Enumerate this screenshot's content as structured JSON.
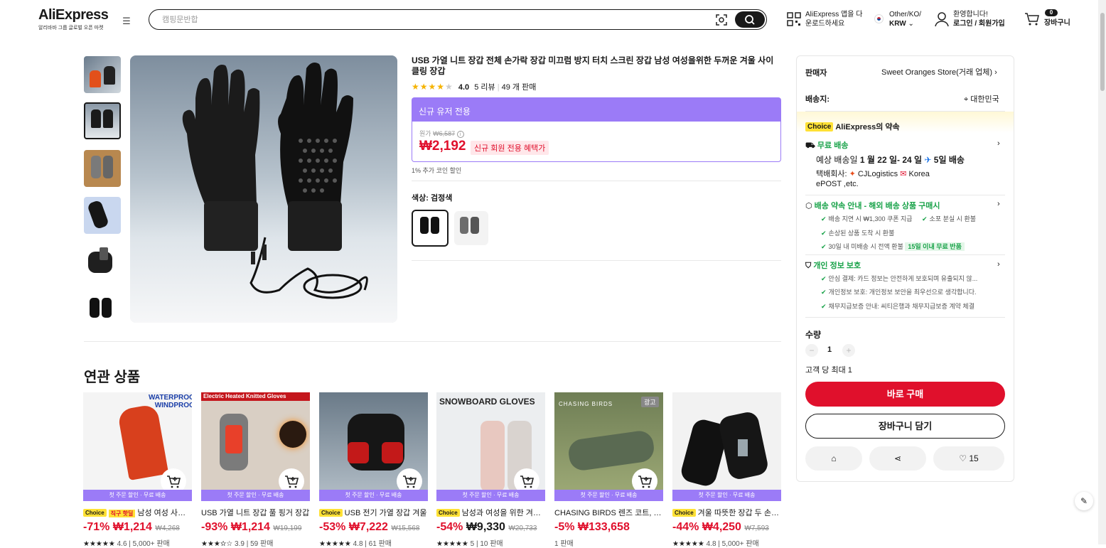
{
  "header": {
    "logo": "AliExpress",
    "logo_sub": "알리바바 그룹 글로벌 오픈 마켓",
    "search_placeholder": "캠핑문반합",
    "app_line1": "AliExpress 앱을 다",
    "app_line2": "운로드하세요",
    "region_line1": "Other/KO/",
    "region_line2": "KRW",
    "greeting": "환영합니다!",
    "login": "로그인 / 회원가입",
    "cart_count": "0",
    "cart_label": "장바구니"
  },
  "product": {
    "title": "USB 가열 니트 장갑 전체 손가락 장갑 미끄럼 방지 터치 스크린 장갑 남성 여성을위한 두꺼운 겨울 사이클링 장갑",
    "rating": "4.0",
    "reviews": "5 리뷰",
    "sold": "49 개 판매",
    "rating_value": 4.0,
    "new_user_banner": "신규 유저 전용",
    "orig_label": "원가",
    "orig_price": "₩6,587",
    "price": "₩2,192",
    "promo_tag": "신규 회원 전용 혜택가",
    "coin": "1% 추가 코인 할인",
    "color_label": "색상: 검정색"
  },
  "panel": {
    "seller_label": "판매자",
    "seller_value": "Sweet Oranges Store(거래 업체)",
    "ship_label": "배송지:",
    "ship_value": "대한민국",
    "choice_badge": "Choice",
    "promise": "AliExpress의 약속",
    "free_ship": "무료 배송",
    "eta_prefix": "예상 배송일",
    "eta_range": "1 월 22 일- 24 일",
    "eta_days": "5일 배송",
    "carrier_prefix": "택배회사:",
    "carrier1": "CJLogistics",
    "carrier2": "Korea",
    "carrier3": "ePOST ,etc.",
    "guarantee_title": "배송 약속 안내 - 해외 배송 상품 구매시",
    "g1": "배송 지연 시 ₩1,300 쿠폰 지급",
    "g2": "소포 분실 시 환불",
    "g3": "손상된 상품 도착 시 환불",
    "g4": "30일 내 미배송 시 전액 환불",
    "g4_tag": "15일 이내 무료 반품",
    "privacy_title": "개인 정보 보호",
    "p1": "안심 결제: 카드 정보는 안전하게 보호되며 유출되지 않...",
    "p2": "개인정보 보호: 개인정보 보안을 최우선으로 생각합니다.",
    "p3": "채무지급보증 안내: 씨티은행과 채무지급보증 계약 체결",
    "qty_label": "수량",
    "qty_value": "1",
    "qty_limit": "고객 당 최대 1",
    "buy_now": "바로 구매",
    "add_cart": "장바구니 담기",
    "wish_count": "15"
  },
  "related": {
    "title": "연관 상품",
    "band": "첫 주문 할인 · 무료 배송",
    "ad_badge": "광고",
    "items": [
      {
        "choice": "Choice",
        "tag": "직구 핫딜",
        "title": "남성 여성 사이클링 장갑",
        "discount": "-71%",
        "price": "₩1,214",
        "orig": "₩4,268",
        "rating": "4.6",
        "sold": "5,000+ 판매",
        "img_text": "WATERPROOF WINDPROOF"
      },
      {
        "choice": "",
        "tag": "",
        "title": "USB 가열 니트 장갑 풀 핑거 장갑",
        "discount": "-93%",
        "price": "₩1,214",
        "orig": "₩19,199",
        "rating": "3.9",
        "sold": "59 판매",
        "img_text": "Electric Heated Knitted Gloves"
      },
      {
        "choice": "Choice",
        "tag": "",
        "title": "USB 전기 가열 장갑 겨울",
        "discount": "-53%",
        "price": "₩7,222",
        "orig": "₩15,568",
        "rating": "4.8",
        "sold": "61 판매",
        "img_text": ""
      },
      {
        "choice": "Choice",
        "tag": "",
        "title": "남성과 여성을 위한 겨울 장갑",
        "discount": "-54%",
        "price": "₩9,330",
        "orig": "₩20,733",
        "rating": "5",
        "sold": "10 판매",
        "img_text": "SNOWBOARD GLOVES"
      },
      {
        "choice": "",
        "tag": "",
        "title": "CHASING BIRDS 렌즈 코트, 카메라",
        "discount": "-5%",
        "price": "₩133,658",
        "orig": "",
        "rating": "",
        "sold": "1 판매",
        "img_text": "CHASING BIRDS"
      },
      {
        "choice": "Choice",
        "tag": "",
        "title": "겨울 따뜻한 장갑 두 손가락",
        "discount": "-44%",
        "price": "₩4,250",
        "orig": "₩7,593",
        "rating": "4.8",
        "sold": "5,000+ 판매",
        "img_text": ""
      }
    ]
  },
  "colors": {
    "accent": "#e0102c",
    "purple": "#9b7bf7",
    "green": "#1aa34a",
    "choice": "#ffe135"
  }
}
